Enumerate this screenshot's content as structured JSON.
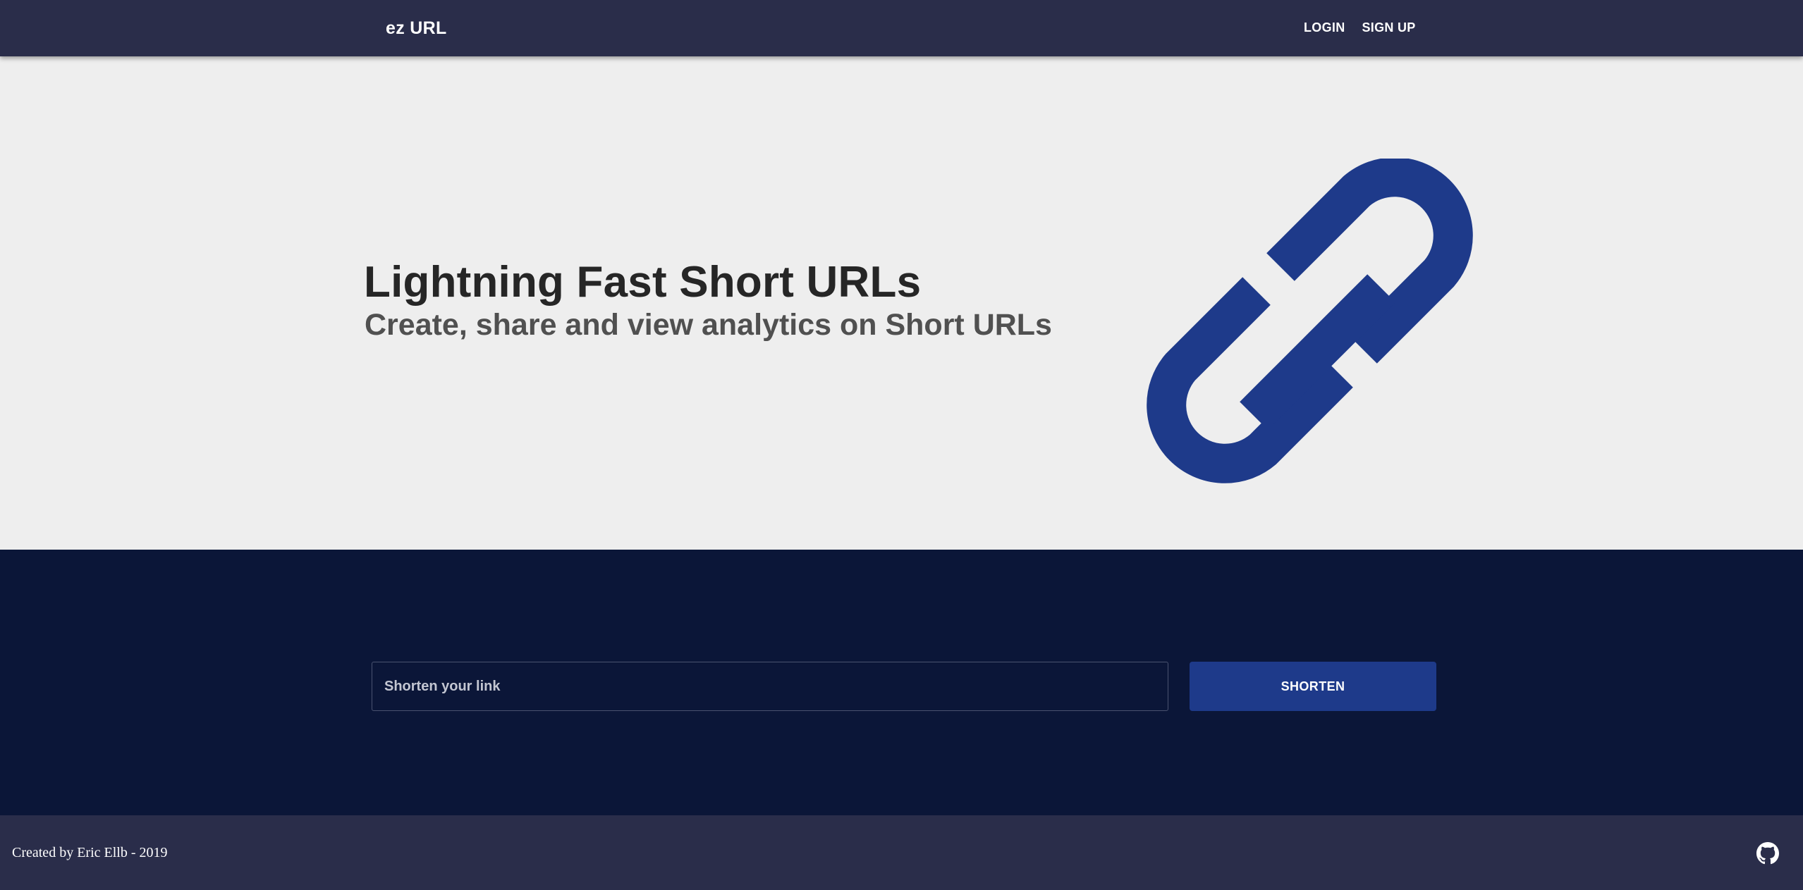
{
  "header": {
    "brand": "ez URL",
    "nav": {
      "login_label": "LOGIN",
      "signup_label": "SIGN UP"
    }
  },
  "hero": {
    "title": "Lightning Fast Short URLs",
    "subtitle": "Create, share and view analytics on Short URLs",
    "logo_icon": "link-icon"
  },
  "shorten": {
    "input_value": "",
    "input_placeholder": "Shorten your link",
    "button_label": "SHORTEN"
  },
  "footer": {
    "credit": "Created by Eric Ellb - 2019",
    "github_icon": "github-icon"
  },
  "colors": {
    "navbar": "#2a2d4a",
    "hero_bg": "#eeeeee",
    "section_bg": "#0b1638",
    "accent": "#1e3a8a",
    "footer": "#2a2d4a"
  }
}
